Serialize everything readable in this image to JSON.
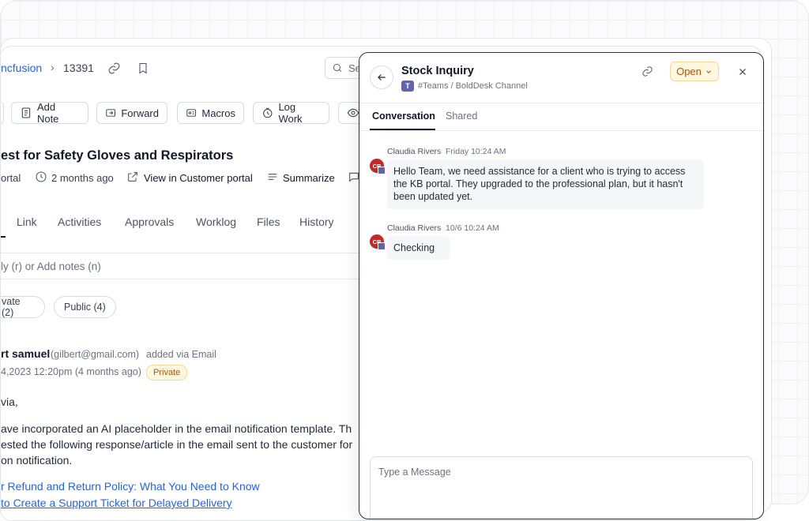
{
  "breadcrumb": {
    "org": "ncfusion",
    "ticket_id": "13391"
  },
  "search": {
    "placeholder": "Se"
  },
  "toolbar": {
    "add_note": "Add Note",
    "forward": "Forward",
    "macros": "Macros",
    "log_work": "Log Work"
  },
  "ticket": {
    "title": "est for Safety Gloves and Respirators",
    "portal_prefix": "ortal",
    "age": "2 months ago",
    "view_portal": "View in Customer portal",
    "summarize": "Summarize"
  },
  "tabs": [
    "Link",
    "Activities",
    "Approvals",
    "Worklog",
    "Files",
    "History"
  ],
  "reply_placeholder": "ly (r) or Add notes (n)",
  "filters": {
    "private": "vate (2)",
    "public": "Public (4)"
  },
  "message": {
    "sender": "rt samuel",
    "email": "(gilbert@gmail.com)",
    "via": "added via Email",
    "date": "4,2023 12:20pm (4 months ago)",
    "badge": "Private",
    "greeting": "via,",
    "body_lines": [
      "ave incorporated an AI placeholder in the email notification template. Th",
      "ested the following response/article in the email sent to the customer for",
      "on notification."
    ],
    "links": [
      "r Refund and Return Policy: What You Need to Know",
      "to Create a Support Ticket for Delayed Delivery"
    ]
  },
  "panel": {
    "title": "Stock Inquiry",
    "channel": "#Teams / BoldDesk Channel",
    "status": "Open",
    "tabs": {
      "conversation": "Conversation",
      "shared": "Shared"
    },
    "messages": [
      {
        "initials": "CR",
        "author": "Claudia Rivers",
        "time": "Friday 10:24 AM",
        "lines": [
          "Hello Team, we need assistance for a client who is trying to access",
          "the KB portal. They upgraded to the professional plan, but it hasn't",
          "been updated yet."
        ]
      },
      {
        "initials": "CR",
        "author": "Claudia Rivers",
        "time": "10/6 10:24 AM",
        "lines": [
          "Checking"
        ]
      }
    ],
    "compose_placeholder": "Type a Message"
  },
  "colors": {
    "accent": "#2563eb",
    "status_bg": "#fff7e0",
    "status_text": "#b45309",
    "avatar": "#c62828",
    "teams": "#6264a7"
  }
}
